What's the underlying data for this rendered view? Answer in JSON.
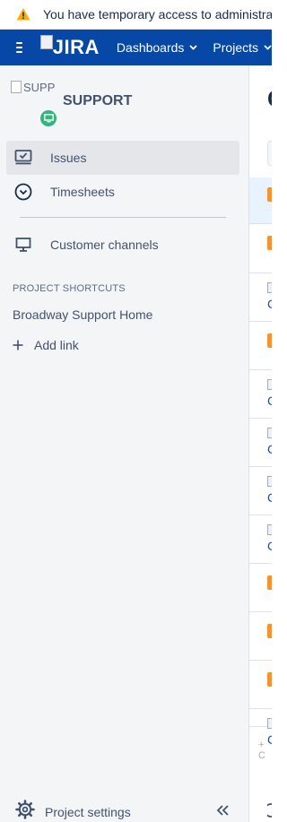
{
  "banner": {
    "icon": "warning-icon",
    "text": "You have temporary access to administrative functions."
  },
  "topnav": {
    "menu_icon": "hamburger-icon",
    "logo_text": "JIRA",
    "items": [
      {
        "label": "Dashboards"
      },
      {
        "label": "Projects"
      }
    ]
  },
  "sidebar": {
    "project": {
      "avatar_alt": "SUPP",
      "name": "SUPPORT"
    },
    "nav": [
      {
        "label": "Issues",
        "icon": "issues-icon",
        "active": true
      },
      {
        "label": "Timesheets",
        "icon": "clock-icon"
      },
      {
        "label": "Customer channels",
        "icon": "monitor-icon"
      }
    ],
    "shortcuts": {
      "title": "PROJECT SHORTCUTS",
      "items": [
        {
          "label": "Broadway Support Home"
        }
      ],
      "add_label": "Add link"
    },
    "settings_label": "Project settings"
  },
  "main": {
    "title_initial": "C",
    "thumb_initial": "C",
    "footer_text": "+ C"
  },
  "colors": {
    "nav_bg": "#0747a6",
    "sidebar_bg": "#f4f5f7",
    "active_bg": "#e4e6ea",
    "warning": "#ffab00",
    "badge": "#36b37e",
    "tag": "#f79232"
  }
}
